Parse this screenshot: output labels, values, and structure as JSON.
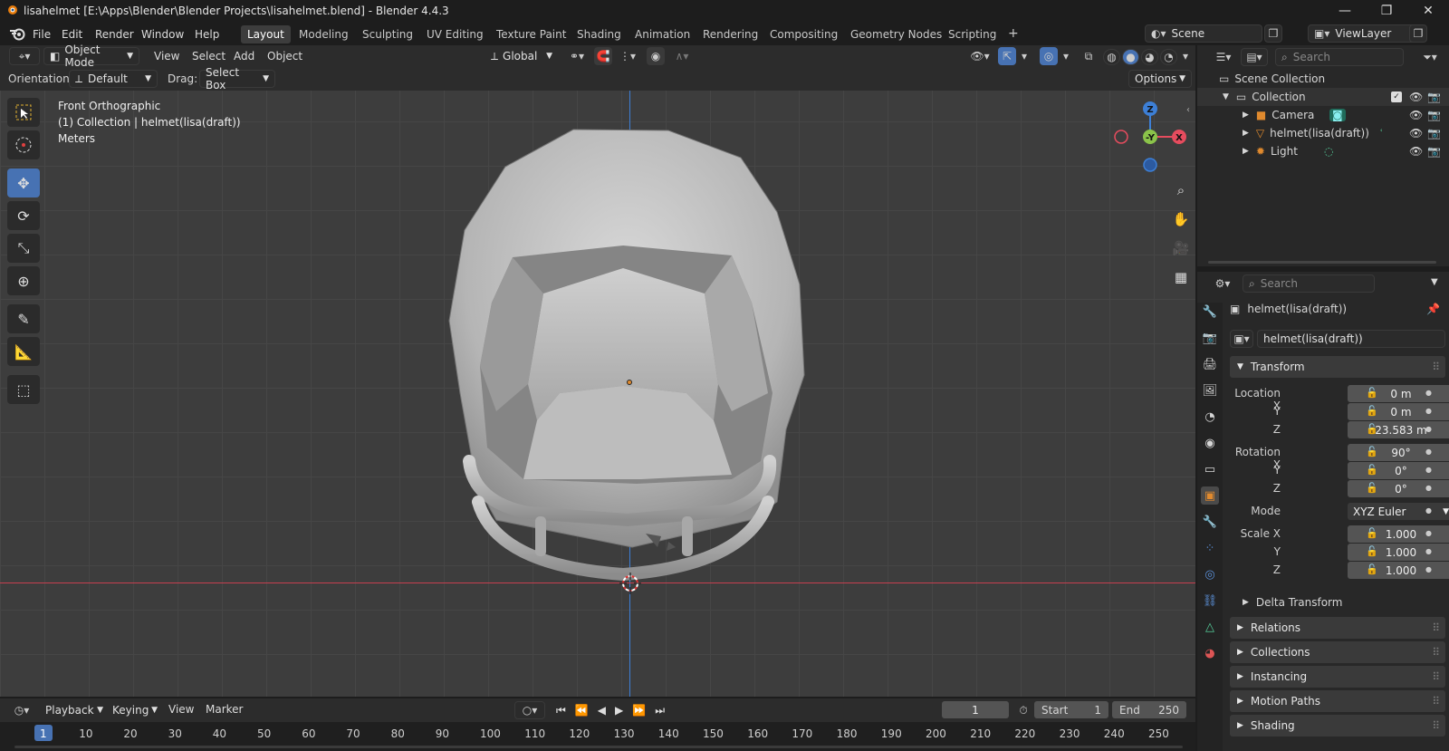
{
  "window": {
    "title": "lisahelmet [E:\\Apps\\Blender\\Blender Projects\\lisahelmet.blend] - Blender 4.4.3",
    "controls": [
      "—",
      "❐",
      "✕"
    ]
  },
  "menubar": {
    "items": [
      "File",
      "Edit",
      "Render",
      "Window",
      "Help"
    ],
    "workspaces": [
      "Layout",
      "Modeling",
      "Sculpting",
      "UV Editing",
      "Texture Paint",
      "Shading",
      "Animation",
      "Rendering",
      "Compositing",
      "Geometry Nodes",
      "Scripting"
    ],
    "active_workspace": "Layout",
    "add_tab": "+",
    "scene": "Scene",
    "view_layer": "ViewLayer"
  },
  "viewport_header": {
    "mode": "Object Mode",
    "menus": [
      "View",
      "Select",
      "Add",
      "Object"
    ],
    "transform_orientation": "Global"
  },
  "tool_settings": {
    "orientation_label": "Orientation:",
    "orientation_value": "Default",
    "drag_label": "Drag:",
    "drag_value": "Select Box",
    "options": "Options"
  },
  "viewport": {
    "view_name": "Front Orthographic",
    "collection_info": "(1) Collection | helmet(lisa(draft))",
    "units": "Meters",
    "gizmo_axes": [
      "Z",
      "-Y",
      "X"
    ]
  },
  "outliner": {
    "search_placeholder": "Search",
    "root": "Scene Collection",
    "collection": "Collection",
    "objects": [
      "Camera",
      "helmet(lisa(draft))",
      "Light"
    ]
  },
  "properties": {
    "search_placeholder": "Search",
    "object_name": "helmet(lisa(draft))",
    "datablock_name": "helmet(lisa(draft))",
    "transform_label": "Transform",
    "location": {
      "label_x": "Location X",
      "x": "0 m",
      "y": "0 m",
      "z": "23.583 m"
    },
    "rotation": {
      "label_x": "Rotation X",
      "x": "90°",
      "y": "0°",
      "z": "0°"
    },
    "mode_label": "Mode",
    "mode_value": "XYZ Euler",
    "scale": {
      "label_x": "Scale X",
      "x": "1.000",
      "y": "1.000",
      "z": "1.000"
    },
    "axis_labels": [
      "Y",
      "Z"
    ],
    "delta": "Delta Transform",
    "panels": [
      "Relations",
      "Collections",
      "Instancing",
      "Motion Paths",
      "Shading"
    ]
  },
  "timeline": {
    "menus": [
      "Playback",
      "Keying",
      "View",
      "Marker"
    ],
    "current_frame": "1",
    "start_label": "Start",
    "start": "1",
    "end_label": "End",
    "end": "250",
    "ticks": [
      "1",
      "10",
      "20",
      "30",
      "40",
      "50",
      "60",
      "70",
      "80",
      "90",
      "100",
      "110",
      "120",
      "130",
      "140",
      "150",
      "160",
      "170",
      "180",
      "190",
      "200",
      "210",
      "220",
      "230",
      "240",
      "250"
    ]
  },
  "colors": {
    "accent": "#4772b3",
    "x_axis": "#e64c5e",
    "y_axis": "#8bc34a",
    "z_axis": "#3d7fd6",
    "object_orange": "#e08a2e"
  }
}
